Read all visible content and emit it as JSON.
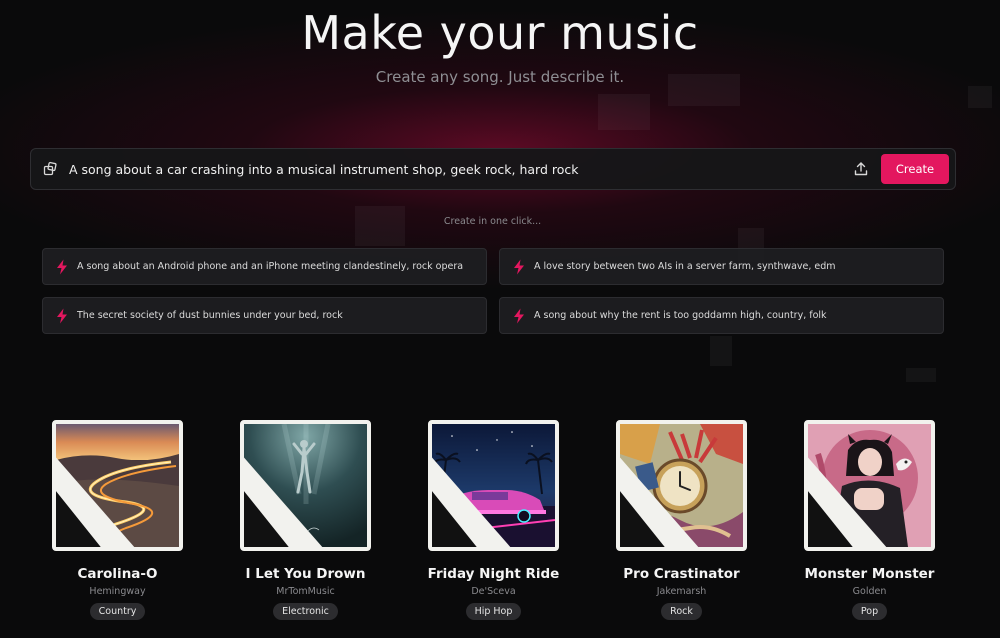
{
  "hero": {
    "title": "Make your music",
    "subtitle": "Create any song. Just describe it."
  },
  "prompt": {
    "value": "A song about a car crashing into a musical instrument shop, geek rock, hard rock",
    "leading_icon": "dice-icon",
    "upload_icon": "upload-icon",
    "create_label": "Create"
  },
  "one_click": {
    "label": "Create in one click...",
    "items": [
      {
        "text": "A song about an Android phone and an iPhone meeting clandestinely, rock opera"
      },
      {
        "text": "A love story between two AIs in a server farm, synthwave, edm"
      },
      {
        "text": "The secret society of dust bunnies under your bed, rock"
      },
      {
        "text": "A song about why the rent is too goddamn high, country, folk"
      }
    ]
  },
  "songs": [
    {
      "title": "Carolina-O",
      "artist": "Hemingway",
      "genre": "Country"
    },
    {
      "title": "I Let You Drown",
      "artist": "MrTomMusic",
      "genre": "Electronic"
    },
    {
      "title": "Friday Night Ride",
      "artist": "De'Sceva",
      "genre": "Hip Hop"
    },
    {
      "title": "Pro Crastinator",
      "artist": "Jakemarsh",
      "genre": "Rock"
    },
    {
      "title": "Monster Monster",
      "artist": "Golden",
      "genre": "Pop"
    }
  ],
  "colors": {
    "accent": "#e3175f",
    "background": "#0a0a0b",
    "card": "#1e1e21"
  }
}
